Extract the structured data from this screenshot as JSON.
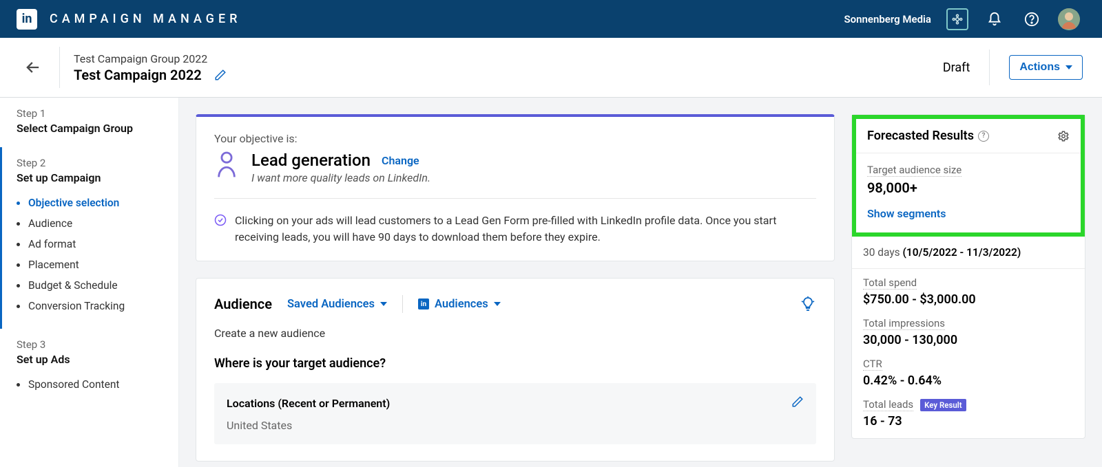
{
  "header": {
    "app_title": "CAMPAIGN MANAGER",
    "account_name": "Sonnenberg Media"
  },
  "subheader": {
    "campaign_group": "Test Campaign Group 2022",
    "campaign_name": "Test Campaign 2022",
    "status": "Draft",
    "actions_label": "Actions"
  },
  "sidebar": {
    "step1": {
      "num": "Step 1",
      "name": "Select Campaign Group"
    },
    "step2": {
      "num": "Step 2",
      "name": "Set up Campaign",
      "items": [
        "Objective selection",
        "Audience",
        "Ad format",
        "Placement",
        "Budget & Schedule",
        "Conversion Tracking"
      ]
    },
    "step3": {
      "num": "Step 3",
      "name": "Set up Ads",
      "items": [
        "Sponsored Content"
      ]
    }
  },
  "objective": {
    "intro": "Your objective is:",
    "value": "Lead generation",
    "change": "Change",
    "desc": "I want more quality leads on LinkedIn.",
    "info": "Clicking on your ads will lead customers to a Lead Gen Form pre-filled with LinkedIn profile data. Once you start receiving leads, you will have 90 days to download them before they expire."
  },
  "audience": {
    "title": "Audience",
    "saved": "Saved Audiences",
    "audiences": "Audiences",
    "create": "Create a new audience",
    "question": "Where is your target audience?",
    "loc_label": "Locations (Recent or Permanent)",
    "loc_value": "United States"
  },
  "forecast": {
    "title": "Forecasted Results",
    "target_label": "Target audience size",
    "target_value": "98,000+",
    "show_segments": "Show segments",
    "range_prefix": "30 days",
    "range_value": "(10/5/2022 - 11/3/2022)",
    "spend_label": "Total spend",
    "spend_value": "$750.00 - $3,000.00",
    "impressions_label": "Total impressions",
    "impressions_value": "30,000 - 130,000",
    "ctr_label": "CTR",
    "ctr_value": "0.42% - 0.64%",
    "leads_label": "Total leads",
    "leads_badge": "Key Result",
    "leads_value": "16 - 73"
  }
}
